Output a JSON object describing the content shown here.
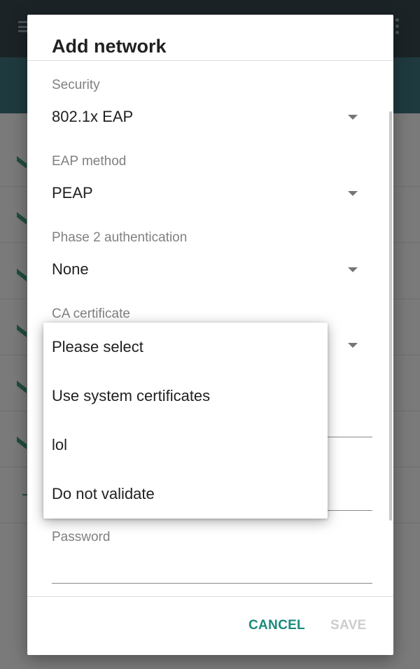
{
  "dialog": {
    "title": "Add network",
    "fields": {
      "security": {
        "label": "Security",
        "value": "802.1x EAP"
      },
      "eap_method": {
        "label": "EAP method",
        "value": "PEAP"
      },
      "phase2": {
        "label": "Phase 2 authentication",
        "value": "None"
      },
      "ca_certificate": {
        "label": "CA certificate"
      },
      "password": {
        "label": "Password",
        "value": ""
      }
    },
    "buttons": {
      "cancel": "CANCEL",
      "save": "SAVE"
    }
  },
  "dropdown": {
    "items": [
      "Please select",
      "Use system certificates",
      "lol",
      "Do not validate"
    ]
  },
  "colors": {
    "accent": "#1a8a7c",
    "disabled": "#cccccc",
    "label": "#808080",
    "text": "#212121"
  }
}
